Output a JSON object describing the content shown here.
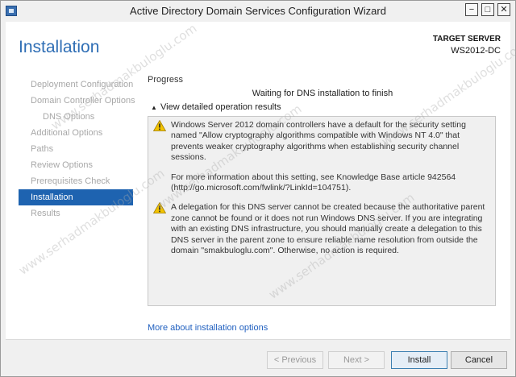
{
  "window": {
    "title": "Active Directory Domain Services Configuration Wizard",
    "buttons": {
      "minimize": "−",
      "maximize": "□",
      "close": "✕"
    }
  },
  "header": {
    "title": "Installation",
    "target_label": "TARGET SERVER",
    "target_name": "WS2012-DC"
  },
  "sidebar": {
    "items": [
      {
        "label": "Deployment Configuration"
      },
      {
        "label": "Domain Controller Options"
      },
      {
        "label": "DNS Options"
      },
      {
        "label": "Additional Options"
      },
      {
        "label": "Paths"
      },
      {
        "label": "Review Options"
      },
      {
        "label": "Prerequisites Check"
      },
      {
        "label": "Installation"
      },
      {
        "label": "Results"
      }
    ]
  },
  "main": {
    "progress_label": "Progress",
    "status": "Waiting for DNS installation to finish",
    "expander_label": "View detailed operation results",
    "warnings": [
      {
        "icon": "warning-icon",
        "paragraphs": [
          "Windows Server 2012 domain controllers have a default for the security setting named \"Allow cryptography algorithms compatible with Windows NT 4.0\" that prevents weaker cryptography algorithms when establishing security channel sessions.",
          "For more information about this setting, see Knowledge Base article 942564 (http://go.microsoft.com/fwlink/?LinkId=104751)."
        ]
      },
      {
        "icon": "warning-icon",
        "paragraphs": [
          "A delegation for this DNS server cannot be created because the authoritative parent zone cannot be found or it does not run Windows DNS server. If you are integrating with an existing DNS infrastructure, you should manually create a delegation to this DNS server in the parent zone to ensure reliable name resolution from outside the domain \"smakbuloglu.com\". Otherwise, no action is required."
        ]
      }
    ],
    "more_link": "More about installation options"
  },
  "footer": {
    "previous": "< Previous",
    "next": "Next >",
    "install": "Install",
    "cancel": "Cancel"
  },
  "watermark": "www.serhadmakbuloglu.com",
  "colors": {
    "accent": "#2f6eb5",
    "nav_active": "#1e63b0",
    "link": "#1f5fbf",
    "warning": "#f2c300"
  }
}
